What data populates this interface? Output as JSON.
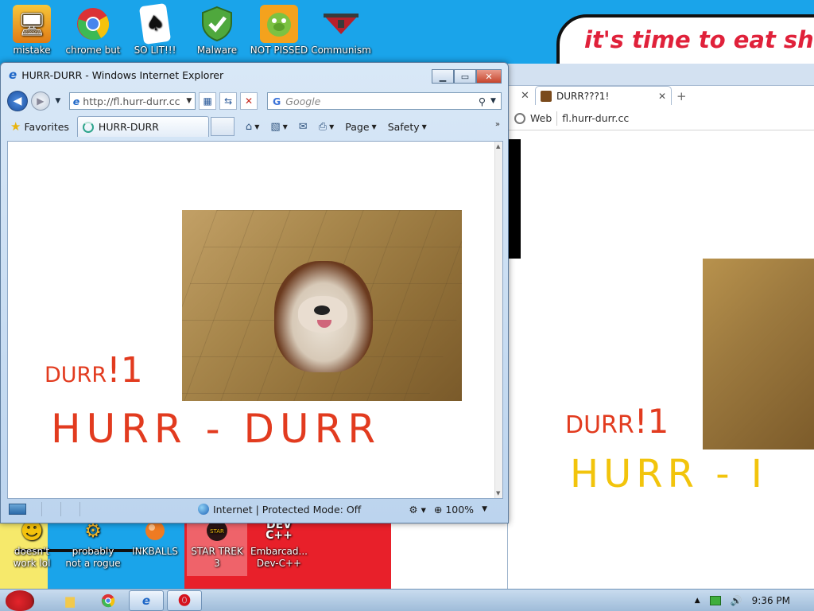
{
  "desktop": {
    "speech_text": "it's time to eat shit",
    "icons_top": [
      {
        "label": "mistake",
        "icon": "monitor-tools-icon"
      },
      {
        "label": "chrome but",
        "icon": "chrome-icon"
      },
      {
        "label": "SO LIT!!!",
        "icon": "playing-card-icon"
      },
      {
        "label": "Malware",
        "icon": "shield-check-icon"
      },
      {
        "label": "NOT PISSED",
        "icon": "green-pig-icon"
      },
      {
        "label": "Communism",
        "icon": "emblem-icon"
      }
    ],
    "icons_bottom": [
      {
        "label": "doesn't work lol",
        "icon": "smiley-icon"
      },
      {
        "label": "probably not a rogue",
        "icon": "gear-chart-icon"
      },
      {
        "label": "INKBALLS",
        "icon": "inkball-icon"
      },
      {
        "label": "STAR TREK 3",
        "icon": "star-wars-icon"
      },
      {
        "label": "Embarcad... Dev-C++",
        "icon": "devcpp-icon"
      }
    ]
  },
  "chrome": {
    "tab_title": "DURR???1!",
    "omni_scheme": "Web",
    "omni_url": "fl.hurr-durr.cc",
    "page_durr_small": "DURR",
    "page_durr_big": "!1",
    "page_hurr": "HURR - I"
  },
  "ie": {
    "title": "HURR-DURR - Windows Internet Explorer",
    "address": "http://fl.hurr-durr.cc",
    "search_placeholder": "Google",
    "favorites_label": "Favorites",
    "tab_title": "HURR-DURR",
    "page_menu": "Page",
    "safety_menu": "Safety",
    "page_durr_small": "DURR",
    "page_durr_big": "!1",
    "page_hurr": "HURR - DURR",
    "status_zone": "Internet | Protected Mode: Off",
    "zoom": "100%"
  },
  "taskbar": {
    "clock": "9:36 PM"
  },
  "colors": {
    "desktop_blue": "#1aa4ea",
    "hurr_red": "#e23b1f",
    "hurr_yellow": "#f2c40c",
    "speech_red": "#e0213a"
  }
}
